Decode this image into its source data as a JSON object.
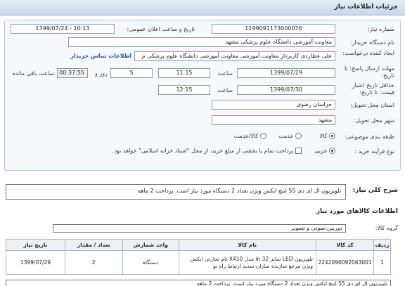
{
  "header": {
    "title": "جزئیات اطلاعات نیاز"
  },
  "form": {
    "need_number_label": "شماره نیاز:",
    "need_number": "1199091173000076",
    "announce_label": "تاریخ و ساعت اعلان عمومی:",
    "announce_value": "1399/07/24 - 10:13",
    "buyer_label": "نام دستگاه خریدار:",
    "buyer_value": "معاونت آموزشی دانشگاه علوم پزشکی مشهد",
    "creator_label": "ایجاد کننده درخواست:",
    "creator_value": "علی عطاردی کاربرداز معاونت آموزشی معاونت آموزشی دانشگاه علوم پزشکی م",
    "contact_link": "اطلاعات تماس خریدار",
    "deadline_label": "مهلت ارسال پاسخ: تا تاریخ:",
    "deadline_date": "1399/07/29",
    "time_label": "ساعت",
    "deadline_time": "11:15",
    "days_value": "5",
    "days_label": "روز و",
    "remaining_time": "00:37:55",
    "remaining_label": "ساعت باقی مانده",
    "validity_label": "حداقل تاریخ اعتبار قیمت: تا تاریخ:",
    "validity_date": "1399/07/30",
    "validity_time": "12:15",
    "province_label": "استان محل تحویل:",
    "province_value": "خراسان رضوی",
    "city_label": "شهر محل تحویل:",
    "city_value": "مشهد",
    "category_label": "طبقه بندی موضوعی:",
    "category_options": [
      "کالا",
      "خدمت",
      "کالا/خدمت"
    ],
    "process_label": "نوع فرآیند خرید :",
    "process_option": "جزیی",
    "process_note": "پرداخت تمام یا بخشی از مبلغ خرید، از محل \"اسناد خزانه اسلامی\" خواهد بود."
  },
  "summary": {
    "title": "شرح کلی نیاز:",
    "text": "تلویزیون ال ای دی 55 اینچ ایکس ویژن تعداد 2 دستگاه مورد نیاز است. پرداخت 2 ماهه"
  },
  "goods": {
    "title": "اطلاعات کالاهای مورد نیاز",
    "group_label": "گروه کالا:",
    "group_value": "دوربین،صوتی و تصویر",
    "columns": [
      "ردیف",
      "کد کالا",
      "نام کالا",
      "واحد شمارش",
      "تعداد / مقدار",
      "تاریخ نیاز"
    ],
    "rows": [
      {
        "row": "1",
        "code": "2242090092063001",
        "name": "تلویزیون LED سایز 32 in مدل X410 نام تجارتی ایکس ویژن مرجع سازنده سازان سدید ارتباط راه نو",
        "unit": "دستگاه",
        "qty": "2",
        "date": "1399/07/29"
      }
    ]
  },
  "bottom_text": "تلویزیون ال ای دی 55 اینچ ایکس ویژن تعداد 2 دستگاه مورد نیاز است. پرداخت 2 ماهه"
}
